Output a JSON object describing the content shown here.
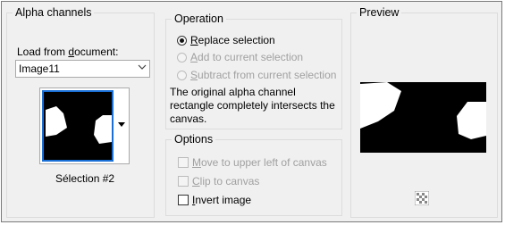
{
  "alpha_channels": {
    "title": "Alpha channels",
    "load_label_pre": "Load from ",
    "load_label_ul": "d",
    "load_label_post": "ocument:",
    "document_value": "Image11",
    "selection_label": "Sélection #2"
  },
  "operation": {
    "title": "Operation",
    "options": [
      {
        "ul": "R",
        "rest": "eplace selection",
        "checked": true,
        "disabled": false
      },
      {
        "ul": "A",
        "rest": "dd to current selection",
        "checked": false,
        "disabled": true
      },
      {
        "ul": "S",
        "rest": "ubtract from current selection",
        "checked": false,
        "disabled": true
      }
    ],
    "message": "The original alpha channel rectangle completely intersects the canvas."
  },
  "options": {
    "title": "Options",
    "checkboxes": [
      {
        "ul": "M",
        "rest": "ove to upper left of canvas",
        "checked": false,
        "disabled": true
      },
      {
        "ul": "C",
        "rest": "lip to canvas",
        "checked": false,
        "disabled": true
      },
      {
        "ul": "I",
        "rest": "nvert image",
        "checked": false,
        "disabled": false
      }
    ]
  },
  "preview": {
    "title": "Preview"
  },
  "icons": {
    "dropdown": "chevron-down-icon",
    "thumb_menu": "triangle-down-icon",
    "preview_toggle": "checkerboard-icon"
  }
}
